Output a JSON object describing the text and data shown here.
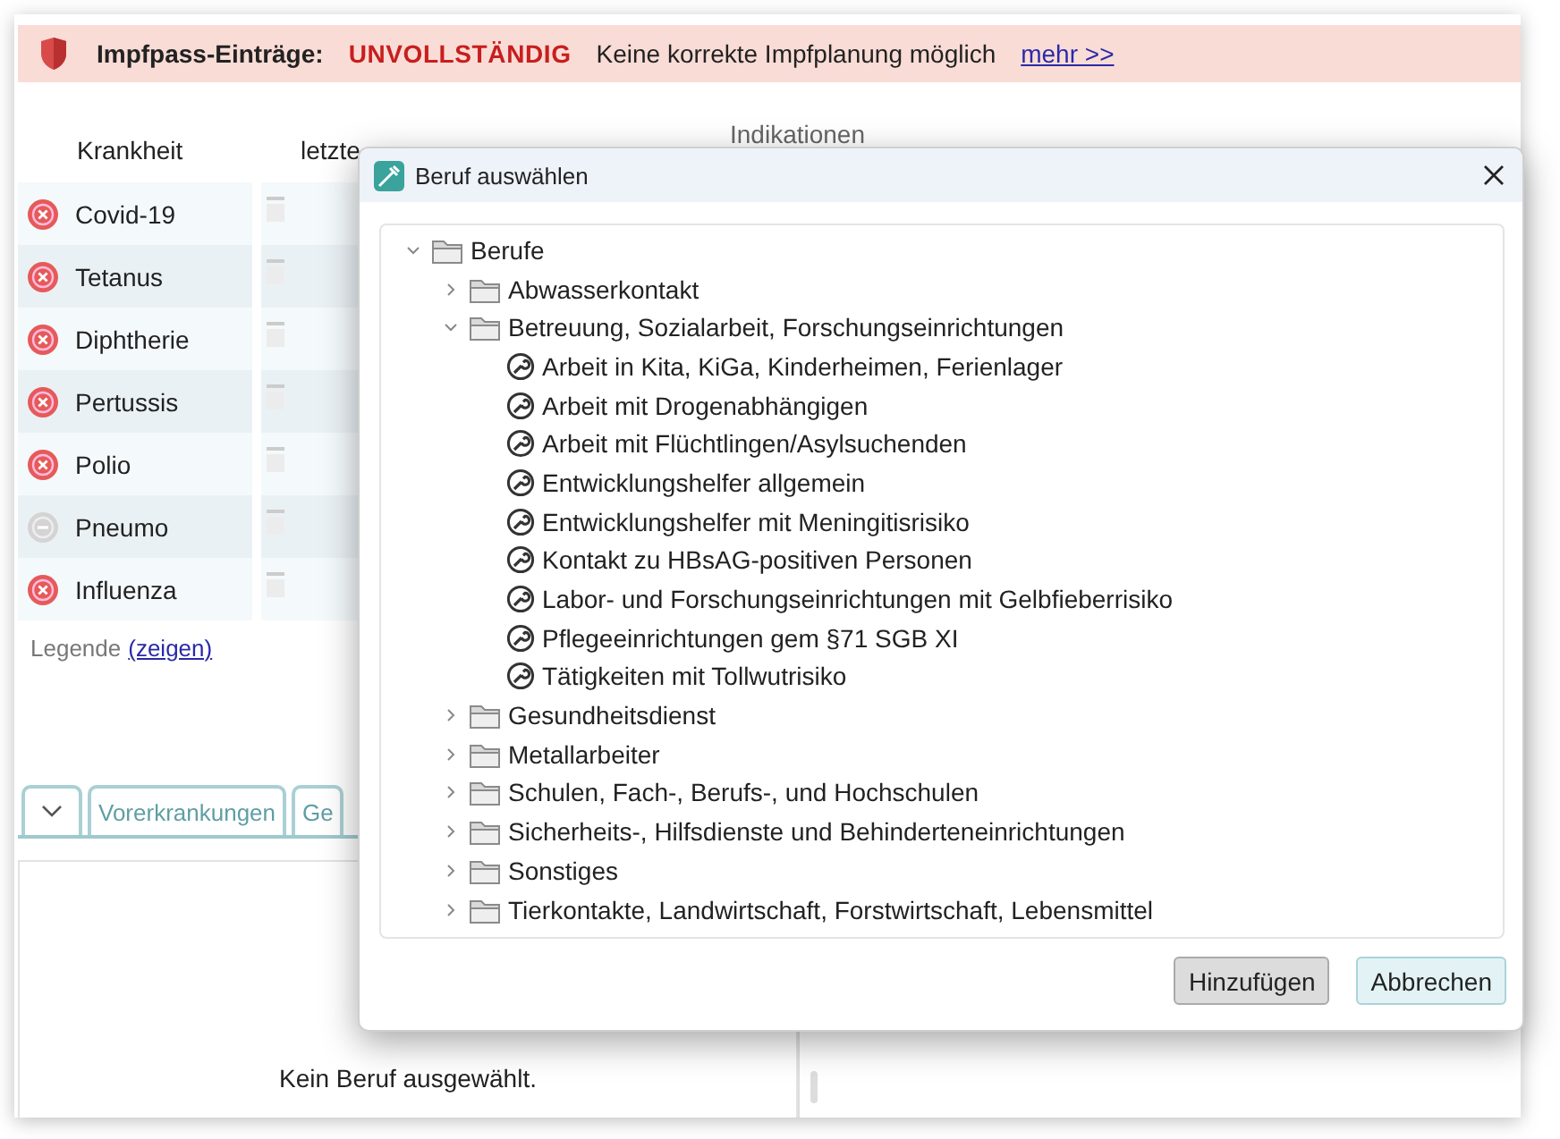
{
  "banner": {
    "label": "Impfpass-Einträge:",
    "status": "UNVOLLSTÄNDIG",
    "message": "Keine korrekte Impfplanung möglich",
    "link": "mehr >>"
  },
  "table": {
    "columns": [
      "Krankheit",
      "letzte"
    ],
    "right_heading": "Indikationen",
    "rows": [
      {
        "name": "Covid-19",
        "kind": "error"
      },
      {
        "name": "Tetanus",
        "kind": "error"
      },
      {
        "name": "Diphtherie",
        "kind": "error"
      },
      {
        "name": "Pertussis",
        "kind": "error"
      },
      {
        "name": "Polio",
        "kind": "error"
      },
      {
        "name": "Pneumo",
        "kind": "neutral"
      },
      {
        "name": "Influenza",
        "kind": "error"
      }
    ]
  },
  "legend": {
    "label": "Legende",
    "link": "(zeigen)"
  },
  "tabs": [
    {
      "label": "Vorerkrankungen",
      "selected": false
    },
    {
      "label": "Ge",
      "selected": false
    }
  ],
  "empty_message": "Kein Beruf ausgewählt.",
  "dialog": {
    "title": "Beruf auswählen",
    "tree": [
      {
        "label": "Berufe",
        "kind": "folder",
        "expanded": true,
        "children": [
          {
            "label": "Abwasserkontakt",
            "kind": "folder",
            "expanded": false
          },
          {
            "label": "Betreuung, Sozialarbeit, Forschungseinrichtungen",
            "kind": "folder",
            "expanded": true,
            "children": [
              {
                "label": "Arbeit in Kita, KiGa, Kinderheimen, Ferienlager",
                "kind": "leaf"
              },
              {
                "label": "Arbeit mit Drogenabhängigen",
                "kind": "leaf"
              },
              {
                "label": "Arbeit mit Flüchtlingen/Asylsuchenden",
                "kind": "leaf"
              },
              {
                "label": "Entwicklungshelfer allgemein",
                "kind": "leaf"
              },
              {
                "label": "Entwicklungshelfer mit Meningitisrisiko",
                "kind": "leaf"
              },
              {
                "label": "Kontakt zu  HBsAG-positiven Personen",
                "kind": "leaf"
              },
              {
                "label": "Labor- und Forschungseinrichtungen mit Gelbfieberrisiko",
                "kind": "leaf"
              },
              {
                "label": "Pflegeeinrichtungen gem §71 SGB XI",
                "kind": "leaf"
              },
              {
                "label": "Tätigkeiten mit Tollwutrisiko",
                "kind": "leaf"
              }
            ]
          },
          {
            "label": "Gesundheitsdienst",
            "kind": "folder",
            "expanded": false
          },
          {
            "label": "Metallarbeiter",
            "kind": "folder",
            "expanded": false
          },
          {
            "label": "Schulen, Fach-, Berufs-, und Hochschulen",
            "kind": "folder",
            "expanded": false
          },
          {
            "label": "Sicherheits-, Hilfsdienste und Behinderteneinrichtungen",
            "kind": "folder",
            "expanded": false
          },
          {
            "label": "Sonstiges",
            "kind": "folder",
            "expanded": false
          },
          {
            "label": "Tierkontakte, Landwirtschaft, Forstwirtschaft, Lebensmittel",
            "kind": "folder",
            "expanded": false
          }
        ]
      }
    ],
    "buttons": [
      {
        "label": "Hinzufügen",
        "kind": "primary"
      },
      {
        "label": "Abbrechen",
        "kind": "cancel"
      }
    ]
  }
}
